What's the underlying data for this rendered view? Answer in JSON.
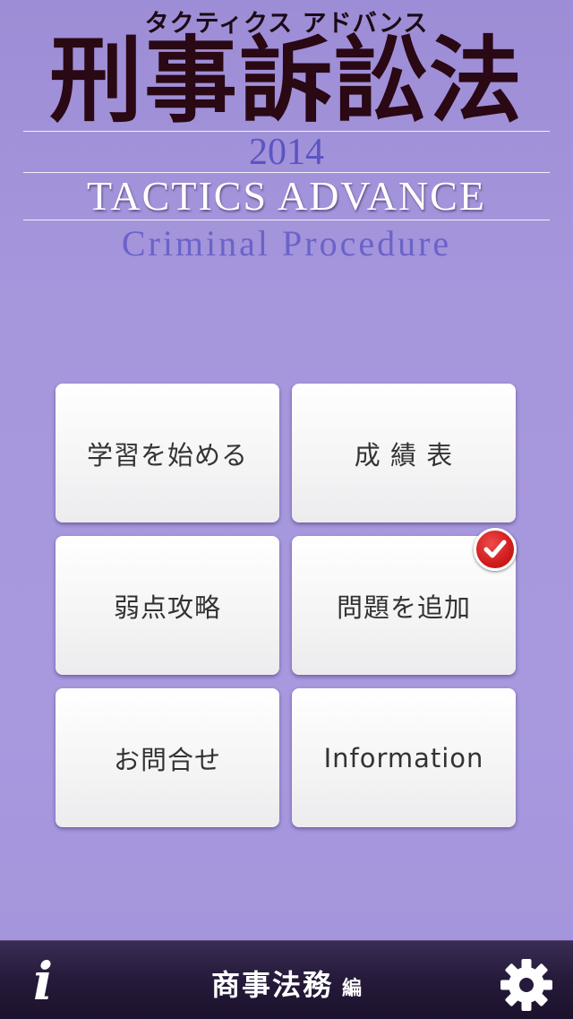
{
  "header": {
    "kana_title": "タクティクス アドバンス",
    "kanji_title": "刑事訴訟法",
    "year": "2014",
    "series_title": "TACTICS ADVANCE",
    "subject_en": "Criminal Procedure"
  },
  "menu": {
    "start_study": "学習を始める",
    "score_table": "成 績 表",
    "weak_points": "弱点攻略",
    "add_questions": "問題を追加",
    "contact": "お問合せ",
    "information": "Information"
  },
  "bottom_bar": {
    "section_title": "商事法務",
    "section_suffix": "編"
  },
  "icons": {
    "info": "info-icon",
    "settings": "gear-icon",
    "badge": "check-badge-icon"
  },
  "colors": {
    "background": "#a696dc",
    "title_dark": "#2a0814",
    "year_blue": "#5a55c2",
    "subject_blue": "#6b63c8",
    "badge_red": "#d11c1c",
    "bottom_bar": "#251a3a"
  }
}
